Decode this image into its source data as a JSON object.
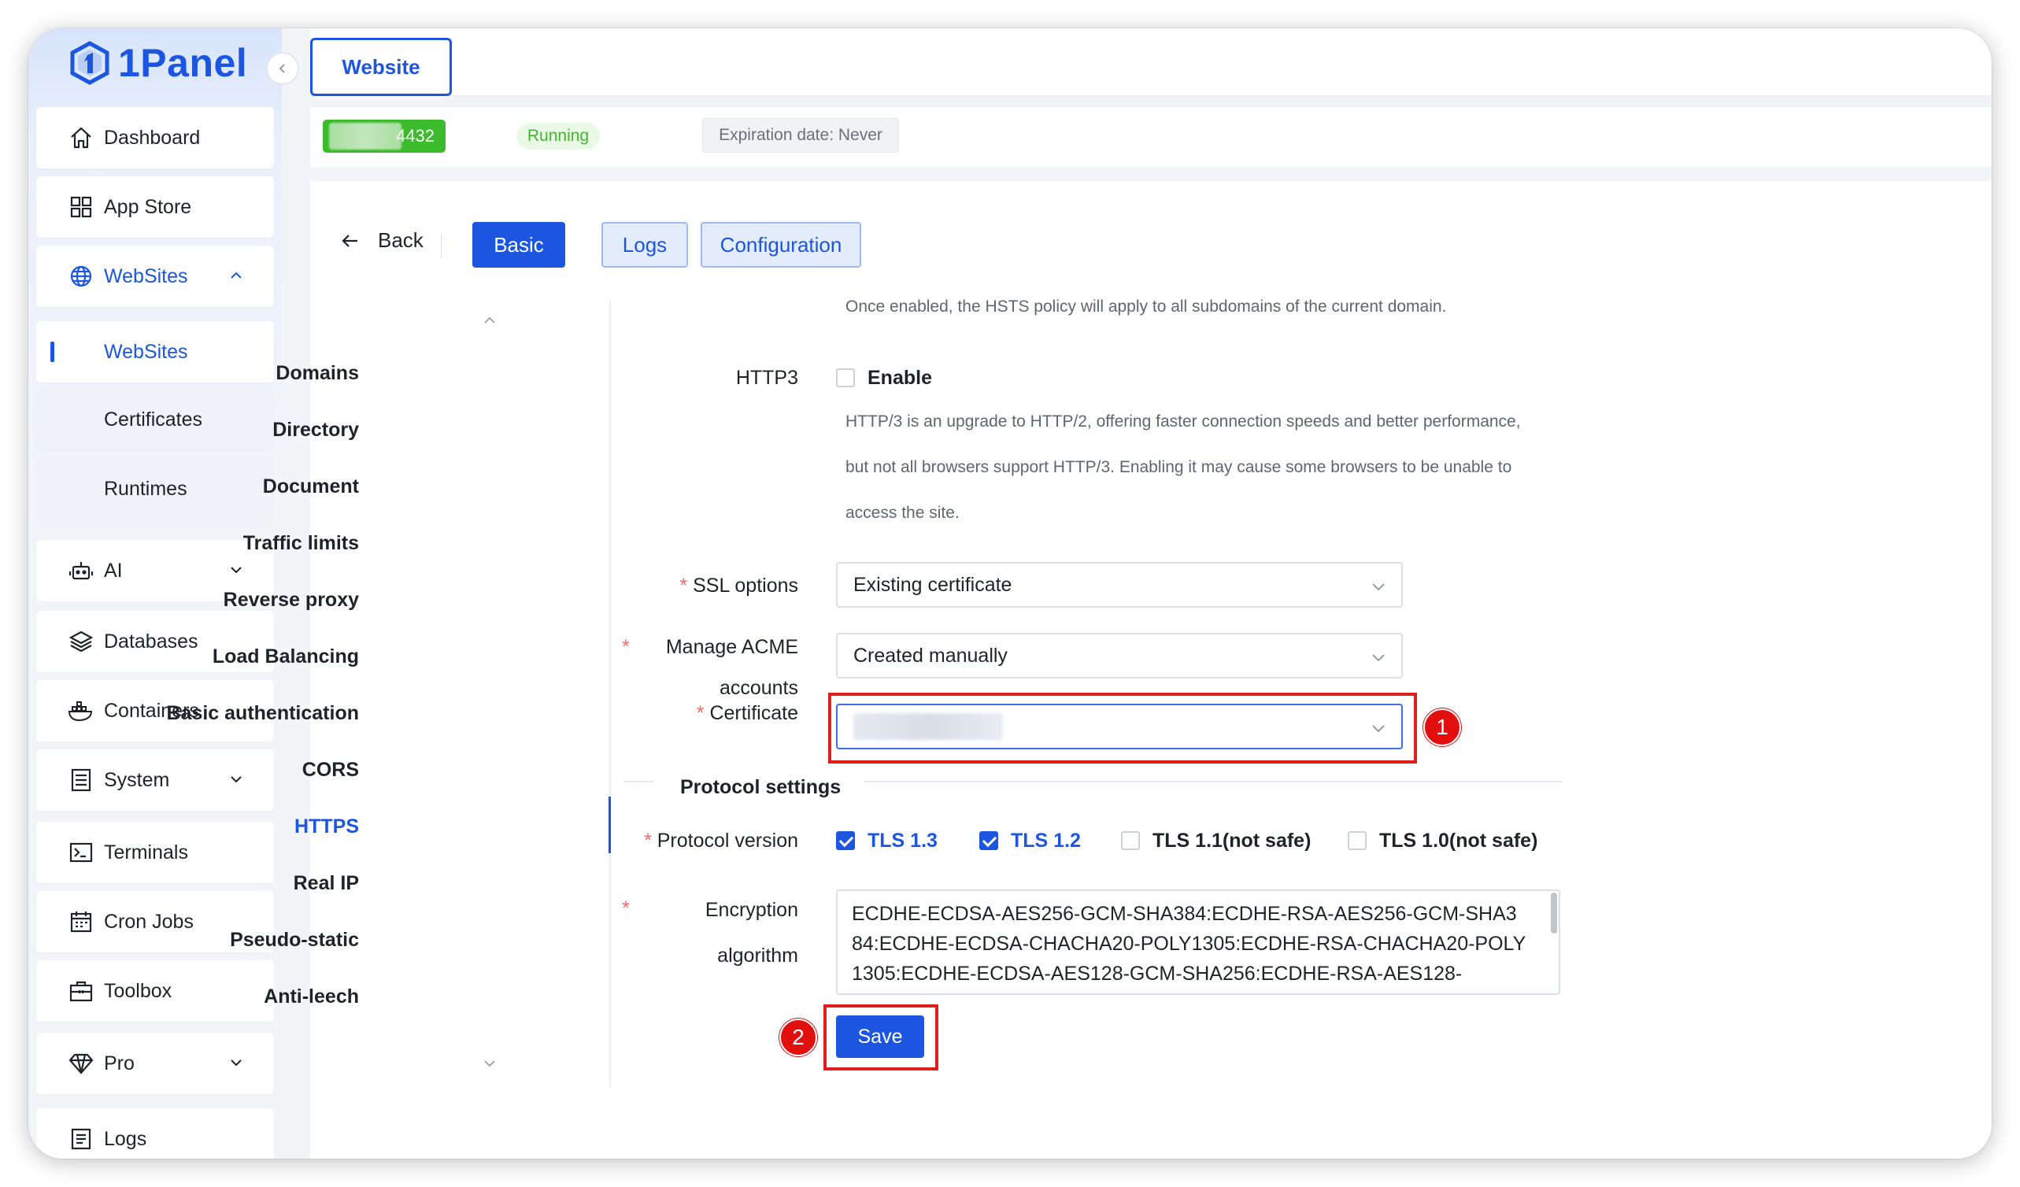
{
  "app": {
    "name": "1Panel"
  },
  "sidebar": {
    "items": [
      {
        "label": "Dashboard"
      },
      {
        "label": "App Store"
      },
      {
        "label": "WebSites"
      },
      {
        "label": "WebSites"
      },
      {
        "label": "Certificates"
      },
      {
        "label": "Runtimes"
      },
      {
        "label": "AI"
      },
      {
        "label": "Databases"
      },
      {
        "label": "Containers"
      },
      {
        "label": "System"
      },
      {
        "label": "Terminals"
      },
      {
        "label": "Cron Jobs"
      },
      {
        "label": "Toolbox"
      },
      {
        "label": "Pro"
      },
      {
        "label": "Logs"
      }
    ]
  },
  "header": {
    "tab": "Website"
  },
  "info": {
    "port": "4432",
    "status": "Running",
    "expiration": "Expiration date: Never"
  },
  "toolbar": {
    "back": "Back",
    "tabs": [
      "Basic",
      "Logs",
      "Configuration"
    ]
  },
  "menu": {
    "items": [
      "Domains",
      "Directory",
      "Document",
      "Traffic limits",
      "Reverse proxy",
      "Load Balancing",
      "Basic authentication",
      "CORS",
      "HTTPS",
      "Real IP",
      "Pseudo-static",
      "Anti-leech"
    ],
    "active": "HTTPS"
  },
  "form": {
    "hsts_help": "Once enabled, the HSTS policy will apply to all subdomains of the current domain.",
    "http3_label": "HTTP3",
    "http3_option": "Enable",
    "http3_help_1": "HTTP/3 is an upgrade to HTTP/2, offering faster connection speeds and better performance,",
    "http3_help_2": "but not all browsers support HTTP/3. Enabling it may cause some browsers to be unable to",
    "http3_help_3": "access the site.",
    "ssl_label": "SSL options",
    "ssl_value": "Existing certificate",
    "acme_label": "Manage ACME",
    "acme_label_2": "accounts",
    "acme_value": "Created manually",
    "cert_label": "Certificate",
    "protocol_section": "Protocol settings",
    "protocol_label": "Protocol version",
    "protocols": [
      {
        "label": "TLS 1.3",
        "checked": true
      },
      {
        "label": "TLS 1.2",
        "checked": true
      },
      {
        "label": "TLS 1.1(not safe)",
        "checked": false
      },
      {
        "label": "TLS 1.0(not safe)",
        "checked": false
      }
    ],
    "cipher_label_1": "Encryption",
    "cipher_label_2": "algorithm",
    "cipher_value": "ECDHE-ECDSA-AES256-GCM-SHA384:ECDHE-RSA-AES256-GCM-SHA384:ECDHE-ECDSA-CHACHA20-POLY1305:ECDHE-RSA-CHACHA20-POLY1305:ECDHE-ECDSA-AES128-GCM-SHA256:ECDHE-RSA-AES128-",
    "save": "Save"
  },
  "annotations": {
    "step1": "1",
    "step2": "2"
  },
  "colors": {
    "primary": "#1c56e0",
    "success": "#3cbc2c",
    "danger": "#e11d1d"
  }
}
